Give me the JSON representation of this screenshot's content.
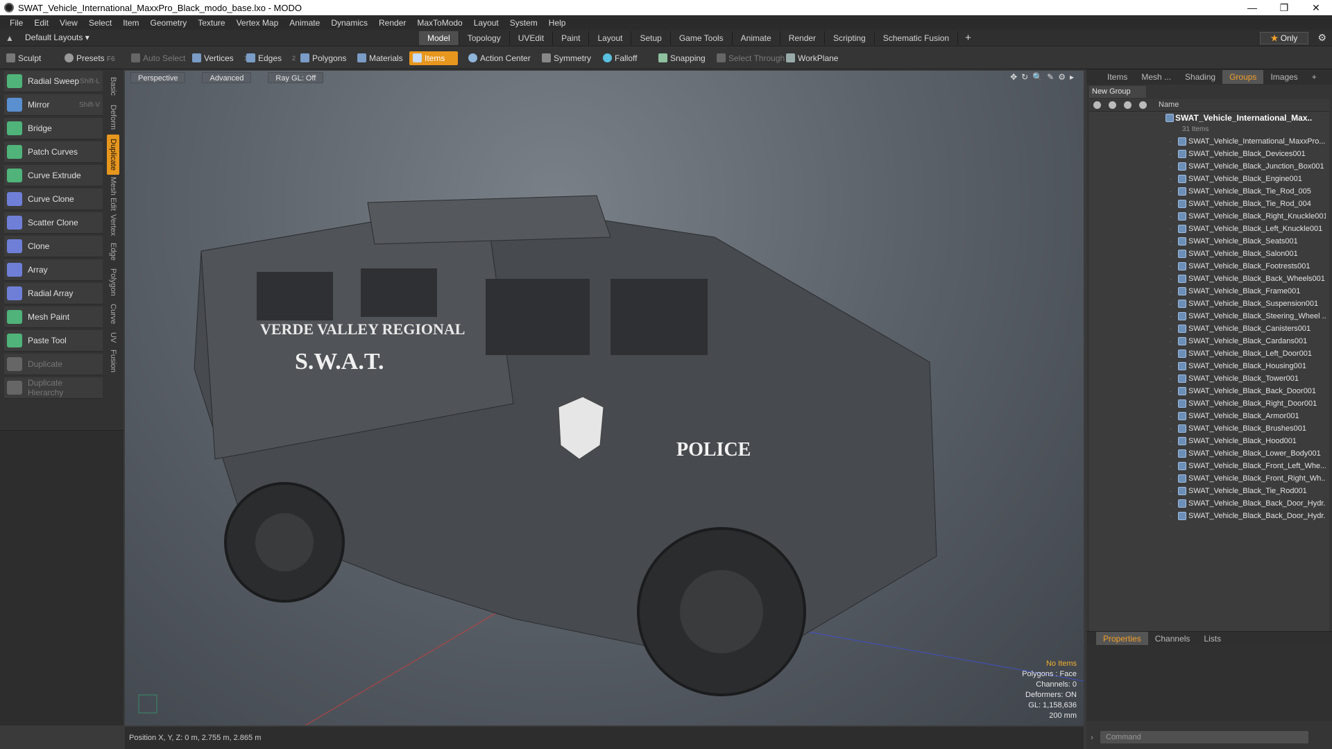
{
  "window": {
    "title": "SWAT_Vehicle_International_MaxxPro_Black_modo_base.lxo - MODO",
    "min": "—",
    "max": "❐",
    "close": "✕"
  },
  "menu": [
    "File",
    "Edit",
    "View",
    "Select",
    "Item",
    "Geometry",
    "Texture",
    "Vertex Map",
    "Animate",
    "Dynamics",
    "Render",
    "MaxToModo",
    "Layout",
    "System",
    "Help"
  ],
  "layout": {
    "selector": "Default Layouts ▾",
    "tabs": [
      "Model",
      "Topology",
      "UVEdit",
      "Paint",
      "Layout",
      "Setup",
      "Game Tools",
      "Animate",
      "Render",
      "Scripting",
      "Schematic Fusion"
    ],
    "active_tab": "Model",
    "plus": "+",
    "only": "Only"
  },
  "toolbar": {
    "sculpt": "Sculpt",
    "presets": "Presets",
    "presets_key": "F6",
    "auto_select": "Auto Select",
    "vertices": "Vertices",
    "vertices_n": "1",
    "edges": "Edges",
    "edges_n": "2",
    "polygons": "Polygons",
    "materials": "Materials",
    "items": "Items",
    "action_center": "Action Center",
    "symmetry": "Symmetry",
    "falloff": "Falloff",
    "snapping": "Snapping",
    "select_through": "Select Through",
    "workplane": "WorkPlane"
  },
  "tools": [
    {
      "label": "Radial Sweep",
      "shortcut": "Shift-L",
      "color": "#4fb37a"
    },
    {
      "label": "Mirror",
      "shortcut": "Shift-V",
      "color": "#5a8fd0"
    },
    {
      "label": "Bridge",
      "shortcut": "",
      "color": "#4fb37a"
    },
    {
      "label": "Patch Curves",
      "shortcut": "",
      "color": "#4fb37a"
    },
    {
      "label": "Curve Extrude",
      "shortcut": "",
      "color": "#4fb37a"
    },
    {
      "label": "Curve Clone",
      "shortcut": "",
      "color": "#6f7fd8"
    },
    {
      "label": "Scatter Clone",
      "shortcut": "",
      "color": "#6f7fd8"
    },
    {
      "label": "Clone",
      "shortcut": "",
      "color": "#6f7fd8"
    },
    {
      "label": "Array",
      "shortcut": "",
      "color": "#6f7fd8"
    },
    {
      "label": "Radial Array",
      "shortcut": "",
      "color": "#6f7fd8"
    },
    {
      "label": "Mesh Paint",
      "shortcut": "",
      "color": "#4fb37a"
    },
    {
      "label": "Paste Tool",
      "shortcut": "",
      "color": "#4fb37a"
    },
    {
      "label": "Duplicate",
      "shortcut": "",
      "color": "#666666"
    },
    {
      "label": "Duplicate Hierarchy",
      "shortcut": "",
      "color": "#666666"
    }
  ],
  "vtabs": [
    "Basic",
    "Deform",
    "Duplicate",
    "Mesh Edit",
    "Vertex",
    "Edge",
    "Polygon",
    "Curve",
    "UV",
    "Fusion"
  ],
  "vtab_active": "Duplicate",
  "viewport": {
    "view": "Perspective",
    "shading": "Advanced",
    "raygl": "Ray GL: Off",
    "icons": "✥↻🔍✎⚙▸"
  },
  "model_text": {
    "line1": "VERDE VALLEY REGIONAL",
    "line2": "S.W.A.T.",
    "police": "POLICE"
  },
  "stats": {
    "no_items": "No Items",
    "polygons": "Polygons : Face",
    "channels": "Channels: 0",
    "deformers": "Deformers: ON",
    "gl": "GL: 1,158,636",
    "scale": "200 mm"
  },
  "status": {
    "position": "Position X, Y, Z:   0 m, 2.755 m, 2.865 m"
  },
  "right": {
    "tabs": [
      "Items",
      "Mesh ...",
      "Shading",
      "Groups",
      "Images"
    ],
    "active": "Groups",
    "plus": "+",
    "new_group": "New Group",
    "col_name": "Name",
    "root": "SWAT_Vehicle_International_Max...",
    "count": "31 Items",
    "items": [
      "SWAT_Vehicle_International_MaxxPro...",
      "SWAT_Vehicle_Black_Devices001",
      "SWAT_Vehicle_Black_Junction_Box001",
      "SWAT_Vehicle_Black_Engine001",
      "SWAT_Vehicle_Black_Tie_Rod_005",
      "SWAT_Vehicle_Black_Tie_Rod_004",
      "SWAT_Vehicle_Black_Right_Knuckle001",
      "SWAT_Vehicle_Black_Left_Knuckle001",
      "SWAT_Vehicle_Black_Seats001",
      "SWAT_Vehicle_Black_Salon001",
      "SWAT_Vehicle_Black_Footrests001",
      "SWAT_Vehicle_Black_Back_Wheels001",
      "SWAT_Vehicle_Black_Frame001",
      "SWAT_Vehicle_Black_Suspension001",
      "SWAT_Vehicle_Black_Steering_Wheel ...",
      "SWAT_Vehicle_Black_Canisters001",
      "SWAT_Vehicle_Black_Cardans001",
      "SWAT_Vehicle_Black_Left_Door001",
      "SWAT_Vehicle_Black_Housing001",
      "SWAT_Vehicle_Black_Tower001",
      "SWAT_Vehicle_Black_Back_Door001",
      "SWAT_Vehicle_Black_Right_Door001",
      "SWAT_Vehicle_Black_Armor001",
      "SWAT_Vehicle_Black_Brushes001",
      "SWAT_Vehicle_Black_Hood001",
      "SWAT_Vehicle_Black_Lower_Body001",
      "SWAT_Vehicle_Black_Front_Left_Whe...",
      "SWAT_Vehicle_Black_Front_Right_Wh...",
      "SWAT_Vehicle_Black_Tie_Rod001",
      "SWAT_Vehicle_Black_Back_Door_Hydr...",
      "SWAT_Vehicle_Black_Back_Door_Hydr..."
    ],
    "prop_tabs": [
      "Properties",
      "Channels",
      "Lists"
    ],
    "prop_active": "Properties",
    "command": "Command"
  },
  "colors": {
    "accent": "#e7961e",
    "selected_tab": "#f2a02a"
  }
}
